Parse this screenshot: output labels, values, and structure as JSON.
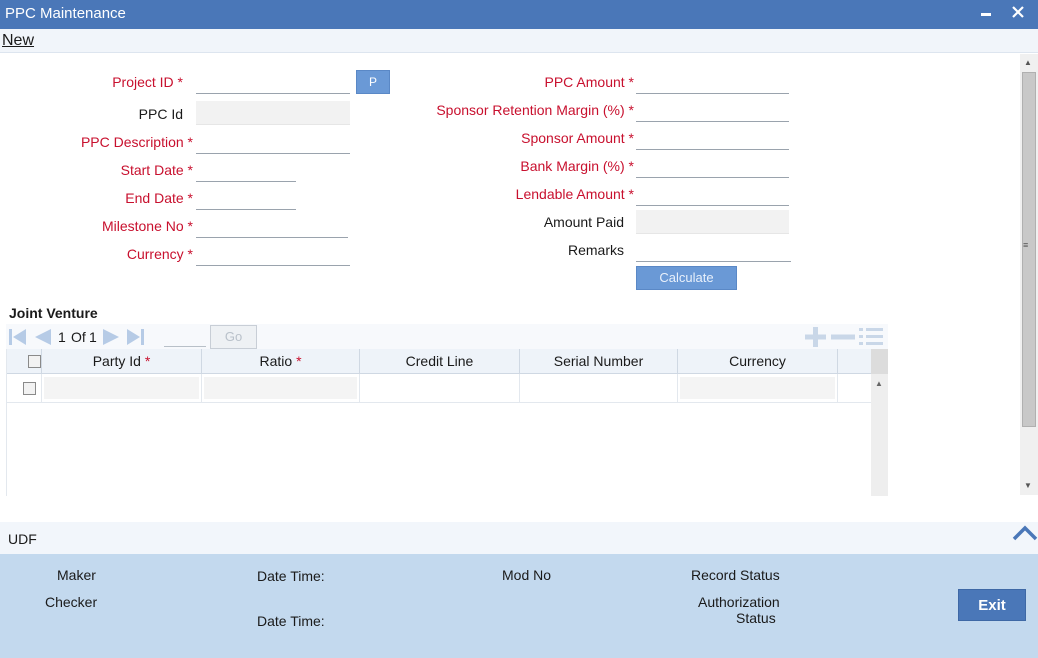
{
  "window": {
    "title": "PPC Maintenance",
    "minimize_glyph": "▬",
    "close_glyph": "✕"
  },
  "toolbar": {
    "new_label": "New"
  },
  "form_left": {
    "project_id": {
      "label": "Project ID",
      "value": ""
    },
    "p_button": "P",
    "ppc_id": {
      "label": "PPC Id",
      "value": ""
    },
    "ppc_description": {
      "label": "PPC Description",
      "value": ""
    },
    "start_date": {
      "label": "Start Date",
      "value": ""
    },
    "end_date": {
      "label": "End Date",
      "value": ""
    },
    "milestone_no": {
      "label": "Milestone No",
      "value": ""
    },
    "currency": {
      "label": "Currency",
      "value": ""
    }
  },
  "form_right": {
    "ppc_amount": {
      "label": "PPC Amount",
      "value": ""
    },
    "sponsor_retention_margin": {
      "label": "Sponsor Retention Margin (%)",
      "value": ""
    },
    "sponsor_amount": {
      "label": "Sponsor Amount",
      "value": ""
    },
    "bank_margin": {
      "label": "Bank Margin (%)",
      "value": ""
    },
    "lendable_amount": {
      "label": "Lendable Amount",
      "value": ""
    },
    "amount_paid": {
      "label": "Amount Paid",
      "value": ""
    },
    "remarks": {
      "label": "Remarks",
      "value": ""
    },
    "calculate_button": "Calculate"
  },
  "joint_venture": {
    "title": "Joint Venture",
    "pager": {
      "current": "1",
      "of_label": "Of",
      "total": "1",
      "go_label": "Go"
    },
    "columns": [
      {
        "label": "Party Id",
        "required": true
      },
      {
        "label": "Ratio",
        "required": true
      },
      {
        "label": "Credit Line",
        "required": false
      },
      {
        "label": "Serial Number",
        "required": false
      },
      {
        "label": "Currency",
        "required": false
      }
    ],
    "required_marker": "*"
  },
  "udf": {
    "label": "UDF"
  },
  "footer": {
    "maker": "Maker",
    "checker": "Checker",
    "date_time_1": "Date Time:",
    "date_time_2": "Date Time:",
    "mod_no": "Mod No",
    "record_status": "Record Status",
    "authorization_line1": "Authorization",
    "authorization_line2": "Status",
    "exit_button": "Exit"
  },
  "required_marker": "*",
  "colors": {
    "titlebar": "#4a77b8",
    "required": "#c8102e",
    "footer": "#c3d9ee",
    "button": "#6a99d6"
  }
}
